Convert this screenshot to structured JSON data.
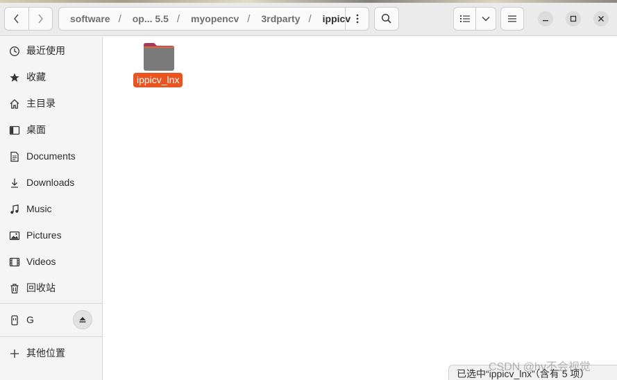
{
  "header": {
    "breadcrumbs": [
      "software",
      "op... 5.5",
      "myopencv",
      "3rdparty",
      "ippicv"
    ],
    "separator": "/"
  },
  "sidebar": {
    "items": [
      {
        "label": "最近使用",
        "icon": "clock-icon"
      },
      {
        "label": "收藏",
        "icon": "star-icon"
      },
      {
        "label": "主目录",
        "icon": "home-icon"
      },
      {
        "label": "桌面",
        "icon": "desktop-icon"
      },
      {
        "label": "Documents",
        "icon": "document-icon"
      },
      {
        "label": "Downloads",
        "icon": "download-icon"
      },
      {
        "label": "Music",
        "icon": "music-icon"
      },
      {
        "label": "Pictures",
        "icon": "picture-icon"
      },
      {
        "label": "Videos",
        "icon": "video-icon"
      },
      {
        "label": "回收站",
        "icon": "trash-icon"
      }
    ],
    "drive": {
      "label": "G",
      "icon": "usb-drive-icon"
    },
    "other": {
      "label": "其他位置",
      "icon": "plus-icon"
    }
  },
  "content": {
    "items": [
      {
        "name": "ippicv_lnx",
        "type": "folder",
        "selected": true
      }
    ]
  },
  "status": {
    "text": "已选中“ippicv_lnx”（含有 5 项）"
  },
  "watermark": "CSDN @hy不会视觉",
  "colors": {
    "accent": "#e95420",
    "folder": "#7a7a7a",
    "folder_tab": "#a33a5b"
  }
}
